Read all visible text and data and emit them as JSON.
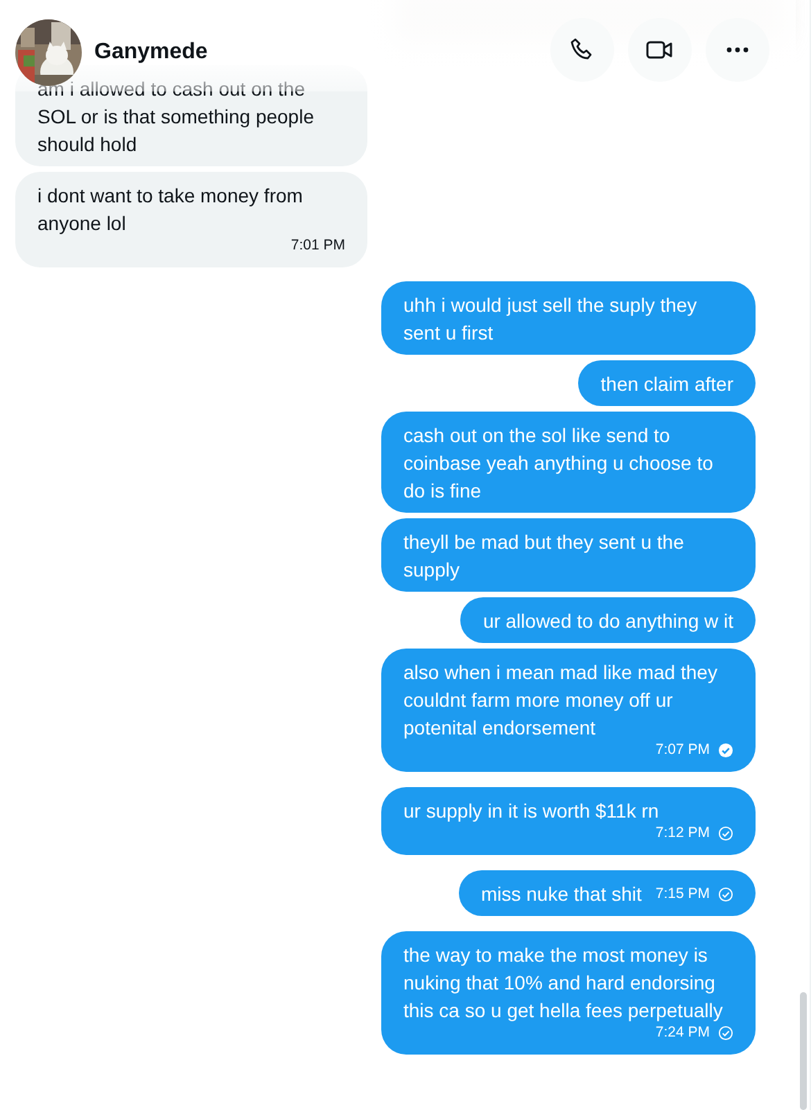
{
  "header": {
    "name": "Ganymede"
  },
  "messages": [
    {
      "kind": "incoming",
      "text": "am i allowed to cash out on the SOL or is that something people should hold"
    },
    {
      "kind": "incoming",
      "text": "i dont want to take money from anyone lol",
      "time": "7:01 PM"
    },
    {
      "kind": "outgoing",
      "text": "uhh i would just sell the suply they sent u first"
    },
    {
      "kind": "outgoing",
      "text": "then claim after"
    },
    {
      "kind": "outgoing",
      "text": "cash out on the sol like send to coinbase yeah anything u choose to do is fine"
    },
    {
      "kind": "outgoing",
      "text": "theyll be mad but they sent u the supply"
    },
    {
      "kind": "outgoing",
      "text": "ur allowed to do anything w it"
    },
    {
      "kind": "outgoing",
      "text": "also when i mean mad like mad they couldnt farm more money off ur potenital endorsement",
      "time": "7:07 PM",
      "read": true
    },
    {
      "kind": "outgoing",
      "text": "ur supply in it is worth $11k rn",
      "time": "7:12 PM",
      "read": false
    },
    {
      "kind": "outgoing",
      "text": "miss nuke that shit",
      "time": "7:15 PM",
      "read": false
    },
    {
      "kind": "outgoing",
      "text": "the way to make the most money is nuking that 10% and hard endorsing this ca so u get hella fees perpetually",
      "time": "7:24 PM",
      "read": false
    }
  ]
}
